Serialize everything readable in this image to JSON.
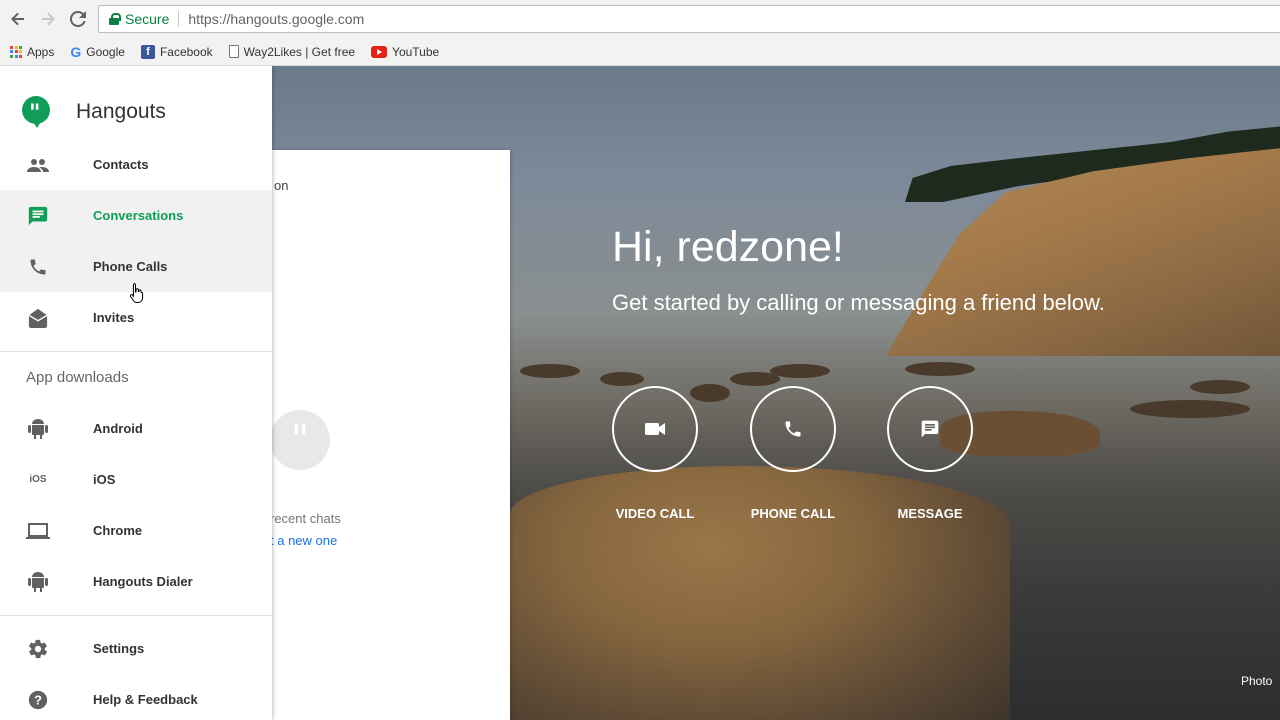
{
  "browser": {
    "secure_label": "Secure",
    "url": "https://hangouts.google.com",
    "bookmarks": [
      {
        "label": "Apps",
        "icon": "apps-grid-icon"
      },
      {
        "label": "Google",
        "icon": "google-icon"
      },
      {
        "label": "Facebook",
        "icon": "facebook-icon"
      },
      {
        "label": "Way2Likes | Get free",
        "icon": "page-icon"
      },
      {
        "label": "YouTube",
        "icon": "youtube-icon"
      }
    ]
  },
  "sidebar": {
    "brand": "Hangouts",
    "items": [
      {
        "label": "Contacts",
        "icon": "contacts-icon"
      },
      {
        "label": "Conversations",
        "icon": "chat-icon"
      },
      {
        "label": "Phone Calls",
        "icon": "phone-icon"
      },
      {
        "label": "Invites",
        "icon": "invites-icon"
      }
    ],
    "downloads_heading": "App downloads",
    "downloads": [
      {
        "label": "Android",
        "icon": "android-icon"
      },
      {
        "label": "iOS",
        "icon": "ios-icon"
      },
      {
        "label": "Chrome",
        "icon": "laptop-icon"
      },
      {
        "label": "Hangouts Dialer",
        "icon": "android-icon"
      }
    ],
    "footer": [
      {
        "label": "Settings",
        "icon": "gear-icon"
      },
      {
        "label": "Help & Feedback",
        "icon": "help-icon"
      }
    ]
  },
  "convo_panel": {
    "title_fragment": "on",
    "empty_text": "recent chats",
    "link_text": "t a new one"
  },
  "main": {
    "greeting": "Hi, redzone!",
    "subtitle": "Get started by calling or messaging a friend below.",
    "actions": [
      {
        "label": "VIDEO CALL",
        "icon": "video-camera-icon"
      },
      {
        "label": "PHONE CALL",
        "icon": "phone-icon"
      },
      {
        "label": "MESSAGE",
        "icon": "message-icon"
      }
    ],
    "photo_credit": "Photo"
  },
  "colors": {
    "brand_green": "#0f9d58",
    "secure_green": "#0b8043",
    "link_blue": "#1a73e8"
  }
}
